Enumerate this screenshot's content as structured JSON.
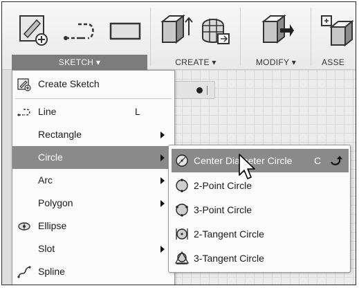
{
  "toolbar": {
    "groups": [
      {
        "label": "SKETCH ▾",
        "active": true
      },
      {
        "label": "CREATE ▾",
        "active": false
      },
      {
        "label": "MODIFY ▾",
        "active": false
      },
      {
        "label": "ASSE",
        "active": false
      }
    ]
  },
  "sketch_menu": {
    "items": [
      {
        "label": "Create Sketch",
        "shortcut": "",
        "icon": "create-sketch-icon",
        "submenu": false
      },
      {
        "label": "Line",
        "shortcut": "L",
        "icon": "line-icon",
        "submenu": false
      },
      {
        "label": "Rectangle",
        "shortcut": "",
        "icon": "",
        "submenu": true
      },
      {
        "label": "Circle",
        "shortcut": "",
        "icon": "",
        "submenu": true,
        "highlighted": true
      },
      {
        "label": "Arc",
        "shortcut": "",
        "icon": "",
        "submenu": true
      },
      {
        "label": "Polygon",
        "shortcut": "",
        "icon": "",
        "submenu": true
      },
      {
        "label": "Ellipse",
        "shortcut": "",
        "icon": "ellipse-icon",
        "submenu": false
      },
      {
        "label": "Slot",
        "shortcut": "",
        "icon": "",
        "submenu": true
      },
      {
        "label": "Spline",
        "shortcut": "",
        "icon": "spline-icon",
        "submenu": false
      }
    ]
  },
  "circle_menu": {
    "items": [
      {
        "label": "Center Diameter Circle",
        "shortcut": "C",
        "icon": "center-diameter-circle-icon",
        "highlighted": true
      },
      {
        "label": "2-Point Circle",
        "shortcut": "",
        "icon": "two-point-circle-icon"
      },
      {
        "label": "3-Point Circle",
        "shortcut": "",
        "icon": "three-point-circle-icon"
      },
      {
        "label": "2-Tangent Circle",
        "shortcut": "",
        "icon": "two-tangent-circle-icon"
      },
      {
        "label": "3-Tangent Circle",
        "shortcut": "",
        "icon": "three-tangent-circle-icon"
      }
    ]
  },
  "colors": {
    "highlight": "#8a8a8a",
    "menu_bg": "#fbfbfb",
    "active_group_bg": "#7c7c7c"
  }
}
